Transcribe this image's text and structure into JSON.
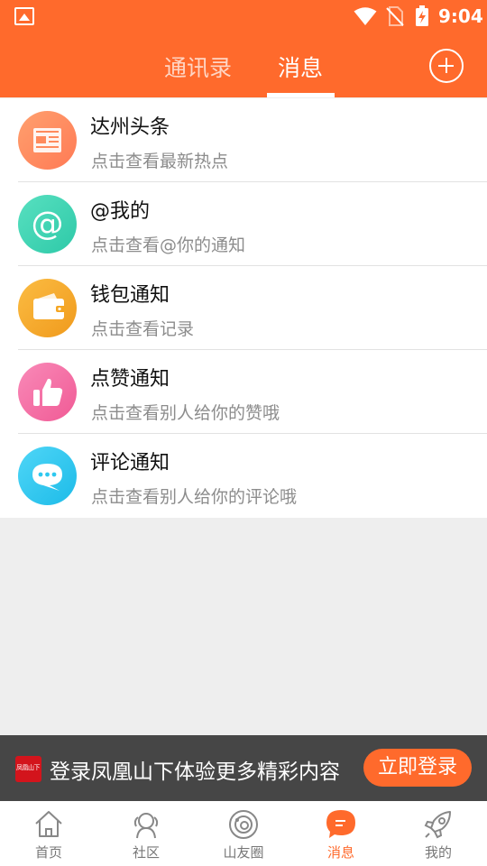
{
  "status_bar": {
    "time": "9:04",
    "icons": [
      "image-icon",
      "wifi-icon",
      "no-sim-icon",
      "battery-charging-icon"
    ]
  },
  "header": {
    "tabs": [
      {
        "label": "通讯录",
        "active": false
      },
      {
        "label": "消息",
        "active": true
      }
    ],
    "add_icon": "plus-circle-icon"
  },
  "messages": [
    {
      "title": "达州头条",
      "subtitle": "点击查看最新热点",
      "icon": "newspaper-icon",
      "color": "#ff8a5c"
    },
    {
      "title": "@我的",
      "subtitle": "点击查看@你的通知",
      "icon": "at-icon",
      "color": "#3fd3b4"
    },
    {
      "title": "钱包通知",
      "subtitle": "点击查看记录",
      "icon": "wallet-icon",
      "color": "#f5a623"
    },
    {
      "title": "点赞通知",
      "subtitle": "点击查看别人给你的赞哦",
      "icon": "thumbs-up-icon",
      "color": "#f56aa2"
    },
    {
      "title": "评论通知",
      "subtitle": "点击查看别人给你的评论哦",
      "icon": "comment-icon",
      "color": "#2ec8f0"
    }
  ],
  "login_banner": {
    "logo_text": "凤凰山下",
    "text": "登录凤凰山下体验更多精彩内容",
    "button": "立即登录"
  },
  "bottom_nav": [
    {
      "label": "首页",
      "icon": "home-icon",
      "active": false
    },
    {
      "label": "社区",
      "icon": "community-icon",
      "active": false
    },
    {
      "label": "山友圈",
      "icon": "friends-circle-icon",
      "active": false
    },
    {
      "label": "消息",
      "icon": "message-icon",
      "active": true
    },
    {
      "label": "我的",
      "icon": "rocket-icon",
      "active": false
    }
  ],
  "colors": {
    "accent": "#ff6a2c",
    "banner_bg": "#464646",
    "background": "#eeeeee"
  }
}
